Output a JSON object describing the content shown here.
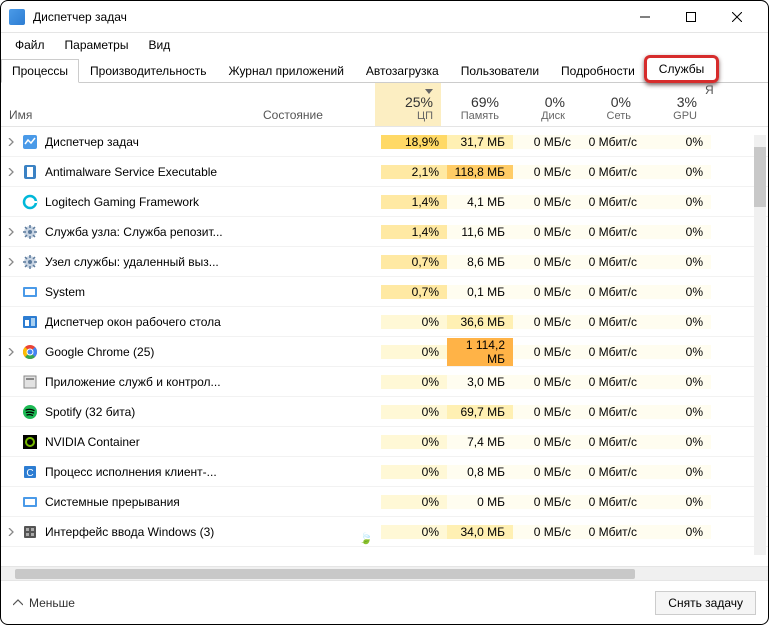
{
  "window": {
    "title": "Диспетчер задач"
  },
  "menu": {
    "file": "Файл",
    "options": "Параметры",
    "view": "Вид"
  },
  "tabs": {
    "processes": "Процессы",
    "performance": "Производительность",
    "app_history": "Журнал приложений",
    "startup": "Автозагрузка",
    "users": "Пользователи",
    "details": "Подробности",
    "services": "Службы"
  },
  "columns": {
    "name": "Имя",
    "state": "Состояние",
    "cpu_pct": "25%",
    "cpu": "ЦП",
    "mem_pct": "69%",
    "mem": "Память",
    "disk_pct": "0%",
    "disk": "Диск",
    "net_pct": "0%",
    "net": "Сеть",
    "gpu_pct": "3%",
    "gpu": "GPU",
    "last": "Я"
  },
  "rows": [
    {
      "expand": true,
      "icon": "taskmgr",
      "name": "Диспетчер задач",
      "cpu": "18,9%",
      "cpu_cls": "cpu-hi",
      "mem": "31,7 МБ",
      "mem_cls": "mem-md",
      "disk": "0 МБ/с",
      "net": "0 Мбит/с",
      "gpu": "0%"
    },
    {
      "expand": true,
      "icon": "shield",
      "name": "Antimalware Service Executable",
      "cpu": "2,1%",
      "cpu_cls": "cpu-md",
      "mem": "118,8 МБ",
      "mem_cls": "mem-hi",
      "disk": "0 МБ/с",
      "net": "0 Мбит/с",
      "gpu": "0%"
    },
    {
      "expand": false,
      "icon": "logitech",
      "name": "Logitech Gaming Framework",
      "cpu": "1,4%",
      "cpu_cls": "cpu-md",
      "mem": "4,1 МБ",
      "mem_cls": "mem-lo",
      "disk": "0 МБ/с",
      "net": "0 Мбит/с",
      "gpu": "0%"
    },
    {
      "expand": true,
      "icon": "service",
      "name": "Служба узла: Служба репозит...",
      "cpu": "1,4%",
      "cpu_cls": "cpu-md",
      "mem": "11,6 МБ",
      "mem_cls": "mem-lo",
      "disk": "0 МБ/с",
      "net": "0 Мбит/с",
      "gpu": "0%"
    },
    {
      "expand": true,
      "icon": "service",
      "name": "Узел службы: удаленный выз...",
      "cpu": "0,7%",
      "cpu_cls": "cpu-md",
      "mem": "8,6 МБ",
      "mem_cls": "mem-lo",
      "disk": "0 МБ/с",
      "net": "0 Мбит/с",
      "gpu": "0%"
    },
    {
      "expand": false,
      "icon": "system",
      "name": "System",
      "cpu": "0,7%",
      "cpu_cls": "cpu-md",
      "mem": "0,1 МБ",
      "mem_cls": "mem-no",
      "disk": "0 МБ/с",
      "net": "0 Мбит/с",
      "gpu": "0%"
    },
    {
      "expand": false,
      "icon": "dwm",
      "name": "Диспетчер окон рабочего стола",
      "cpu": "0%",
      "cpu_cls": "cpu-lo",
      "mem": "36,6 МБ",
      "mem_cls": "mem-md",
      "disk": "0 МБ/с",
      "net": "0 Мбит/с",
      "gpu": "0%"
    },
    {
      "expand": true,
      "icon": "chrome",
      "name": "Google Chrome (25)",
      "cpu": "0%",
      "cpu_cls": "cpu-lo",
      "mem": "1 114,2 МБ",
      "mem_cls": "mem-xh",
      "disk": "0 МБ/с",
      "net": "0 Мбит/с",
      "gpu": "0%"
    },
    {
      "expand": false,
      "icon": "generic",
      "name": "Приложение служб и контрол...",
      "cpu": "0%",
      "cpu_cls": "cpu-lo",
      "mem": "3,0 МБ",
      "mem_cls": "mem-lo",
      "disk": "0 МБ/с",
      "net": "0 Мбит/с",
      "gpu": "0%"
    },
    {
      "expand": false,
      "icon": "spotify",
      "name": "Spotify (32 бита)",
      "cpu": "0%",
      "cpu_cls": "cpu-lo",
      "mem": "69,7 МБ",
      "mem_cls": "mem-md",
      "disk": "0 МБ/с",
      "net": "0 Мбит/с",
      "gpu": "0%"
    },
    {
      "expand": false,
      "icon": "nvidia",
      "name": "NVIDIA Container",
      "cpu": "0%",
      "cpu_cls": "cpu-lo",
      "mem": "7,4 МБ",
      "mem_cls": "mem-lo",
      "disk": "0 МБ/с",
      "net": "0 Мбит/с",
      "gpu": "0%"
    },
    {
      "expand": false,
      "icon": "client",
      "name": "Процесс исполнения клиент-...",
      "cpu": "0%",
      "cpu_cls": "cpu-lo",
      "mem": "0,8 МБ",
      "mem_cls": "mem-no",
      "disk": "0 МБ/с",
      "net": "0 Мбит/с",
      "gpu": "0%"
    },
    {
      "expand": false,
      "icon": "system",
      "name": "Системные прерывания",
      "cpu": "0%",
      "cpu_cls": "cpu-lo",
      "mem": "0 МБ",
      "mem_cls": "mem-no",
      "disk": "0 МБ/с",
      "net": "0 Мбит/с",
      "gpu": "0%"
    },
    {
      "expand": true,
      "icon": "winlogon",
      "name": "Интерфейс ввода Windows (3)",
      "leaf": true,
      "cpu": "0%",
      "cpu_cls": "cpu-lo",
      "mem": "34,0 МБ",
      "mem_cls": "mem-md",
      "disk": "0 МБ/с",
      "net": "0 Мбит/с",
      "gpu": "0%"
    }
  ],
  "footer": {
    "less": "Меньше",
    "end_task": "Снять задачу"
  }
}
